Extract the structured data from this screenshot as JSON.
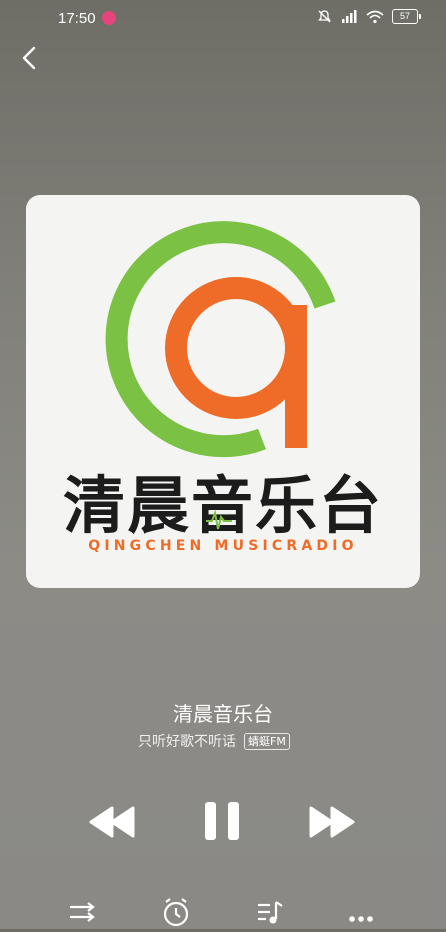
{
  "status_bar": {
    "time": "17:50",
    "battery": "57"
  },
  "cover": {
    "brand_cn": "清晨音乐台",
    "brand_en": "QINGCHEN MUSICRADIO"
  },
  "track": {
    "title": "清晨音乐台",
    "subtitle": "只听好歌不听话",
    "badge": "蜻蜓FM"
  },
  "colors": {
    "green": "#7bc143",
    "orange": "#ee6c27",
    "dark": "#1c1c1c"
  },
  "icons": [
    "back-icon",
    "previous-icon",
    "pause-icon",
    "next-icon",
    "repeat-icon",
    "alarm-icon",
    "playlist-icon",
    "more-icon"
  ]
}
